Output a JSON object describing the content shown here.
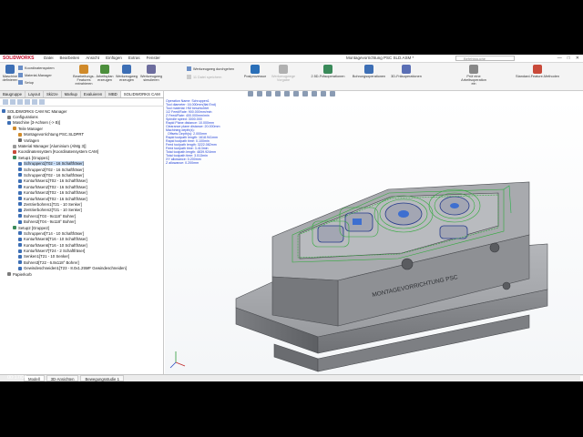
{
  "app": {
    "brand": "SOLIDWORKS",
    "menu": [
      "Datei",
      "Bearbeiten",
      "Ansicht",
      "Einfügen",
      "Extras",
      "Fenster"
    ],
    "document_title": "Montagevorrichtung PSC SLD.ASM *",
    "search_placeholder": "Befehlssuche",
    "window_buttons": [
      "—",
      "□",
      "✕"
    ]
  },
  "ribbon": {
    "buttons": [
      {
        "label": "Maschine definieren",
        "color": "#3d6fb5"
      },
      {
        "label": "Bearbeitungs-Features extrahieren",
        "color": "#d08a2a"
      },
      {
        "label": "Arbeitsplan erzeugen",
        "color": "#4c8f3c"
      },
      {
        "label": "Werkzeugweg erzeugen",
        "color": "#3d6fb5"
      },
      {
        "label": "Werkzeugweg simulieren",
        "color": "#6d6d9e"
      },
      {
        "label": "Postprozessor",
        "color": "#2a6fb8"
      },
      {
        "label": "Werkzeugwege Vorgabe",
        "color": "#b0b0b0"
      },
      {
        "label": "2.5D-Fräsoperationen",
        "color": "#3a8a5a"
      },
      {
        "label": "Bohrungsoperationen",
        "color": "#3d6fb5"
      },
      {
        "label": "3D-Fräsoperationen",
        "color": "#5a6fb5"
      },
      {
        "label": "Prüf eine Arbeitsoperation ein",
        "color": "#888888"
      },
      {
        "label": "Standard-Feature-Methoden",
        "color": "#c94a3a"
      }
    ],
    "small_items": [
      "Koordinatensystem",
      "Material-Manager",
      "Setup",
      "Werkzeugweg durchgehen",
      "11 Datei speichern"
    ]
  },
  "panel_tabs": [
    "Baugruppe",
    "Layout",
    "Skizze",
    "Markup",
    "Evaluieren",
    "MBD",
    "SOLIDWORKS CAM"
  ],
  "tree": [
    {
      "label": "SOLIDWORKS CAM NC Manager",
      "indent": 0,
      "color": "#3d6fb5"
    },
    {
      "label": "Configurations",
      "indent": 1,
      "color": "#7a7a7a"
    },
    {
      "label": "Maschine [3-Achsen (-> B)]",
      "indent": 1,
      "color": "#3d6fb5"
    },
    {
      "label": "Teile Manager",
      "indent": 2,
      "color": "#d08a2a"
    },
    {
      "label": "Montagevorrichtung PSC.SLDPRT",
      "indent": 3,
      "color": "#d08a2a"
    },
    {
      "label": "Vorlagen",
      "indent": 3,
      "color": "#6d6d6d"
    },
    {
      "label": "Material Manager [Aluminium (AlMg 3)]",
      "indent": 2,
      "color": "#9a9a9a"
    },
    {
      "label": "Koordinatensystem [Koordinatensystem CAM]",
      "indent": 2,
      "color": "#c94a3a"
    },
    {
      "label": "Setup1 [Gruppe1]",
      "indent": 2,
      "color": "#3a8a5a"
    },
    {
      "label": "Schruppen1[T02 - 16 Schaftfräser]",
      "indent": 3,
      "color": "#3d6fb5",
      "selected": true
    },
    {
      "label": "Schruppen2[T02 - 16 Schaftfräser]",
      "indent": 3,
      "color": "#3d6fb5"
    },
    {
      "label": "Schruppen3[T02 - 16 Schaftfräser]",
      "indent": 3,
      "color": "#3d6fb5"
    },
    {
      "label": "Konturfräsen1[T02 - 16 Schaftfräser]",
      "indent": 3,
      "color": "#3d6fb5"
    },
    {
      "label": "Konturfräsen2[T02 - 16 Schaftfräser]",
      "indent": 3,
      "color": "#3d6fb5"
    },
    {
      "label": "Konturfräsen3[T02 - 16 Schaftfräser]",
      "indent": 3,
      "color": "#3d6fb5"
    },
    {
      "label": "Konturfräsen4[T02 - 16 Schaftfräser]",
      "indent": 3,
      "color": "#3d6fb5"
    },
    {
      "label": "Zentrierbohren1[T21 - 10 Senker]",
      "indent": 3,
      "color": "#3d6fb5"
    },
    {
      "label": "Zentrierbohren2[T21 - 10 Senker]",
      "indent": 3,
      "color": "#3d6fb5"
    },
    {
      "label": "Bohren1[T03 - 9x118° Bohrer]",
      "indent": 3,
      "color": "#3d6fb5"
    },
    {
      "label": "Bohren2[T04 - 9x118° Bohrer]",
      "indent": 3,
      "color": "#3d6fb5"
    },
    {
      "label": "Setup2 [Gruppe2]",
      "indent": 2,
      "color": "#3a8a5a"
    },
    {
      "label": "Schruppen4[T14 - 10 Schaftfräser]",
      "indent": 3,
      "color": "#3d6fb5"
    },
    {
      "label": "Konturfräsen5[T16 - 10 Schaftfräser]",
      "indent": 3,
      "color": "#3d6fb5"
    },
    {
      "label": "Konturfräsen6[T16 - 10 Schaftfräser]",
      "indent": 3,
      "color": "#3d6fb5"
    },
    {
      "label": "Konturfräsen7[T24 - 2 Schaftfräser]",
      "indent": 3,
      "color": "#3d6fb5"
    },
    {
      "label": "Senken1[T21 - 10 Senker]",
      "indent": 3,
      "color": "#3d6fb5"
    },
    {
      "label": "Bohren3[T22 - 6.8x118° Bohrer]",
      "indent": 3,
      "color": "#3d6fb5"
    },
    {
      "label": "Gewindeschneiden1[T23 - 8.0x1.25MF Gewindeschneiden]",
      "indent": 3,
      "color": "#3d6fb5"
    },
    {
      "label": "Papierkorb",
      "indent": 1,
      "color": "#7a7a7a"
    }
  ],
  "info_overlay": [
    "Operation Name: Schruppen1",
    "Tool diameter: 16.000mm(flat End)",
    "Tool material: HM beschichtet",
    "1/2 Feed/Rate: 900.000mm/min",
    "Z Feed/Rate: 400.000mm/min",
    "Spindle speed: 3000.000",
    "Rapid Plane distance: 10.000mm",
    "Clearance plane distance: 20.000mm",
    "Machining depth(s):",
    "  Offsets Depth(s): 2.000mm",
    "Rapid toolpath length: 1618.941mm",
    "Rapid toolpath time: 0.100min",
    "Feed toolpath length: 3222.082mm",
    "Feed toolpath time: 3.413min",
    "Total toolpath length: 4839.924mm",
    "Total toolpath time: 3.513min",
    "XY allowance: 0.200mm",
    "Z allowance: 0.200mm"
  ],
  "model_label": "MONTAGEVORRICHTUNG PSC",
  "bottom_tabs": [
    "Modell",
    "3D-Ansichten",
    "Bewegungsstudie 1"
  ],
  "video_timer": "00:17/00"
}
